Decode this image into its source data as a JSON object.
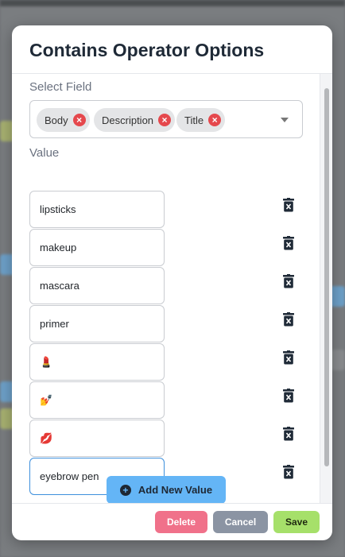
{
  "modal": {
    "title": "Contains Operator Options",
    "select_field_label": "Select Field",
    "selected_fields": [
      "Body",
      "Description",
      "Title"
    ],
    "value_label": "Value",
    "values": [
      "lipsticks",
      "makeup",
      "mascara",
      "primer",
      "💄",
      "💅",
      "💋",
      "eyebrow pen"
    ],
    "add_button_label": "Add New Value",
    "buttons": {
      "delete": "Delete",
      "cancel": "Cancel",
      "save": "Save"
    }
  },
  "colors": {
    "chip_remove": "#e5484d",
    "add_button": "#64b5f6",
    "delete": "#f0718a",
    "cancel": "#8b94a3",
    "save": "#a6e06a",
    "focus_border": "#3d8fdc"
  },
  "icons": {
    "remove_chip": "close-circle-icon",
    "delete_value": "trash-icon",
    "add": "plus-circle-icon",
    "dropdown": "chevron-down-icon"
  }
}
